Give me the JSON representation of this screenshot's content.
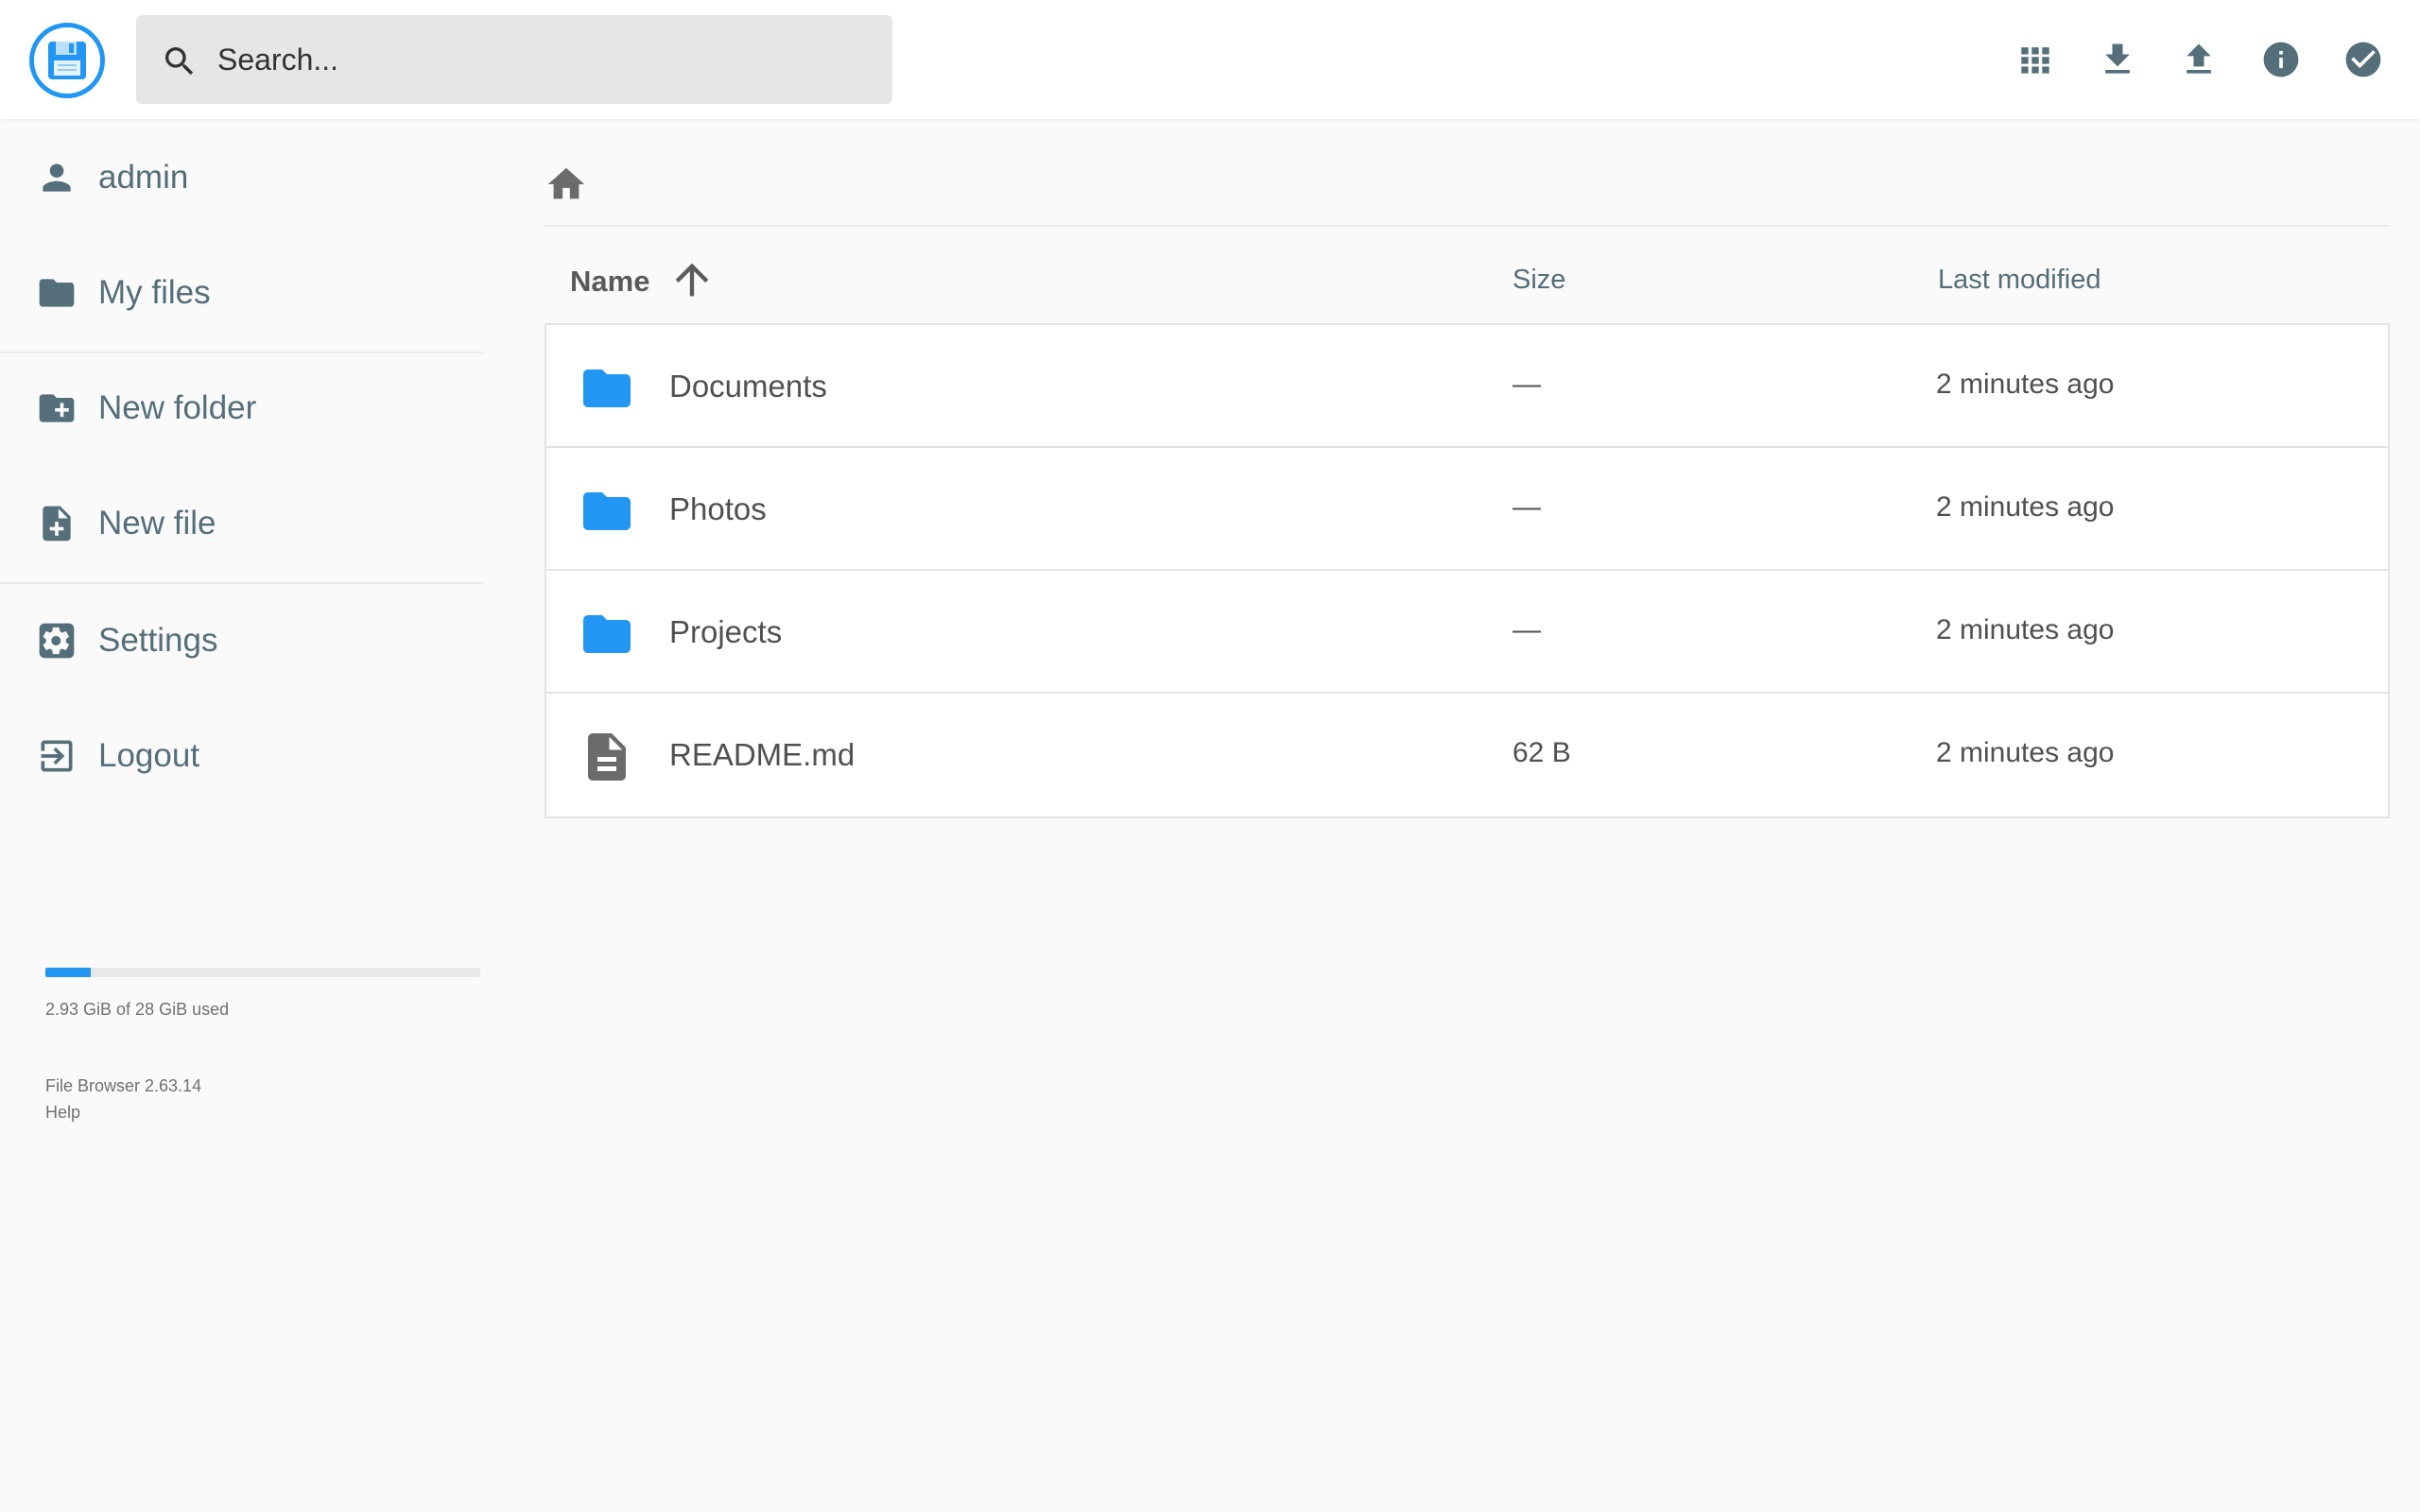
{
  "header": {
    "search_placeholder": "Search...",
    "actions": [
      {
        "name": "grid-view",
        "icon": "grid-icon"
      },
      {
        "name": "download",
        "icon": "download-icon"
      },
      {
        "name": "upload",
        "icon": "upload-icon"
      },
      {
        "name": "info",
        "icon": "info-icon"
      },
      {
        "name": "select",
        "icon": "check-circle-icon"
      }
    ]
  },
  "sidebar": {
    "items": [
      {
        "label": "admin",
        "icon": "person-icon"
      },
      {
        "label": "My files",
        "icon": "folder-icon"
      },
      {
        "label": "New folder",
        "icon": "folder-plus-icon"
      },
      {
        "label": "New file",
        "icon": "file-plus-icon"
      },
      {
        "label": "Settings",
        "icon": "gear-icon"
      },
      {
        "label": "Logout",
        "icon": "logout-icon"
      }
    ],
    "usage": {
      "text": "2.93 GiB of 28 GiB used",
      "fraction": 0.1046
    },
    "version": "File Browser 2.63.14",
    "help": "Help"
  },
  "file_list": {
    "columns": {
      "name": "Name",
      "size": "Size",
      "modified": "Last modified"
    },
    "sort": {
      "column": "name",
      "direction": "ascending"
    },
    "rows": [
      {
        "name": "Documents",
        "type": "folder",
        "size": "—",
        "modified": "2 minutes ago"
      },
      {
        "name": "Photos",
        "type": "folder",
        "size": "—",
        "modified": "2 minutes ago"
      },
      {
        "name": "Projects",
        "type": "folder",
        "size": "—",
        "modified": "2 minutes ago"
      },
      {
        "name": "README.md",
        "type": "file",
        "size": "62 B",
        "modified": "2 minutes ago"
      }
    ]
  },
  "colors": {
    "accent": "#2196f3",
    "icon_gray": "#546e7a",
    "text": "#505050",
    "background": "#fafafa"
  }
}
